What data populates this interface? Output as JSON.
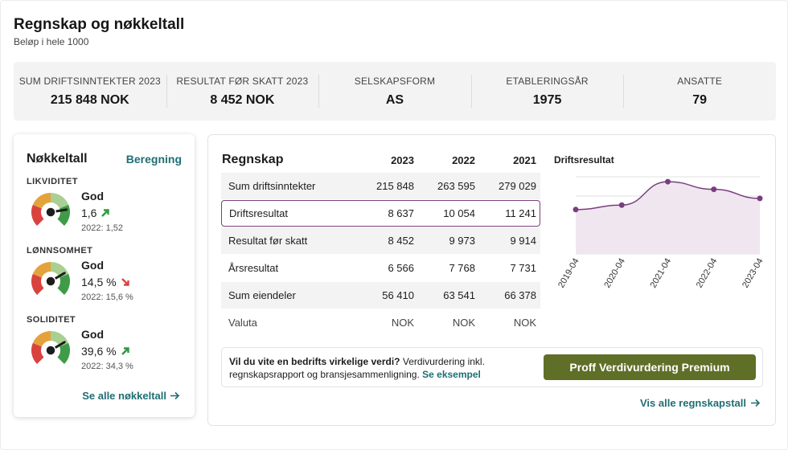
{
  "header": {
    "title": "Regnskap og nøkkeltall",
    "subtitle": "Beløp i hele 1000"
  },
  "kpis": [
    {
      "label": "SUM DRIFTSINNTEKTER 2023",
      "value": "215 848 NOK"
    },
    {
      "label": "RESULTAT FØR SKATT 2023",
      "value": "8 452 NOK"
    },
    {
      "label": "SELSKAPSFORM",
      "value": "AS"
    },
    {
      "label": "ETABLERINGSÅR",
      "value": "1975"
    },
    {
      "label": "ANSATTE",
      "value": "79"
    }
  ],
  "nokkeltall": {
    "title": "Nøkkeltall",
    "calc_link": "Beregning",
    "sections": [
      {
        "label": "LIKVIDITET",
        "status": "God",
        "value": "1,6",
        "trend": "up",
        "previous": "2022: 1,52",
        "needle_level": 0.8
      },
      {
        "label": "LØNNSOMHET",
        "status": "God",
        "value": "14,5 %",
        "trend": "down",
        "previous": "2022: 15,6 %",
        "needle_level": 0.72
      },
      {
        "label": "SOLIDITET",
        "status": "God",
        "value": "39,6 %",
        "trend": "up",
        "previous": "2022: 34,3 %",
        "needle_level": 0.72
      }
    ],
    "see_all": "Se alle nøkkeltall",
    "colors": {
      "up": "#2e9a3e",
      "down": "#d9433f"
    }
  },
  "regnskap": {
    "title": "Regnskap",
    "years": [
      "2023",
      "2022",
      "2021"
    ],
    "rows": [
      {
        "label": "Sum driftsinntekter",
        "values": [
          "215 848",
          "263 595",
          "279 029"
        ]
      },
      {
        "label": "Driftsresultat",
        "values": [
          "8 637",
          "10 054",
          "11 241"
        ]
      },
      {
        "label": "Resultat før skatt",
        "values": [
          "8 452",
          "9 973",
          "9 914"
        ]
      },
      {
        "label": "Årsresultat",
        "values": [
          "6 566",
          "7 768",
          "7 731"
        ]
      },
      {
        "label": "Sum eiendeler",
        "values": [
          "56 410",
          "63 541",
          "66 378"
        ]
      },
      {
        "label": "Valuta",
        "values": [
          "NOK",
          "NOK",
          "NOK"
        ]
      }
    ],
    "highlighted_row": "Driftsresultat",
    "see_all": "Vis alle regnskapstall"
  },
  "chart_data": {
    "type": "area",
    "title": "Driftsresultat",
    "categories": [
      "2019-04",
      "2020-04",
      "2021-04",
      "2022-04",
      "2023-04"
    ],
    "values": [
      6900,
      7600,
      11241,
      10054,
      8637
    ],
    "ylim": [
      0,
      12000
    ],
    "grid": true,
    "color": "#7a3e7e",
    "fill": "#efe6ef"
  },
  "promo": {
    "bold": "Vil du vite en bedrifts virkelige verdi?",
    "text": " Verdivurdering inkl. regnskapsrapport og bransjesammenligning. ",
    "link": "Se eksempel",
    "button": "Proff Verdivurdering Premium",
    "button_color": "#5f6f27"
  }
}
